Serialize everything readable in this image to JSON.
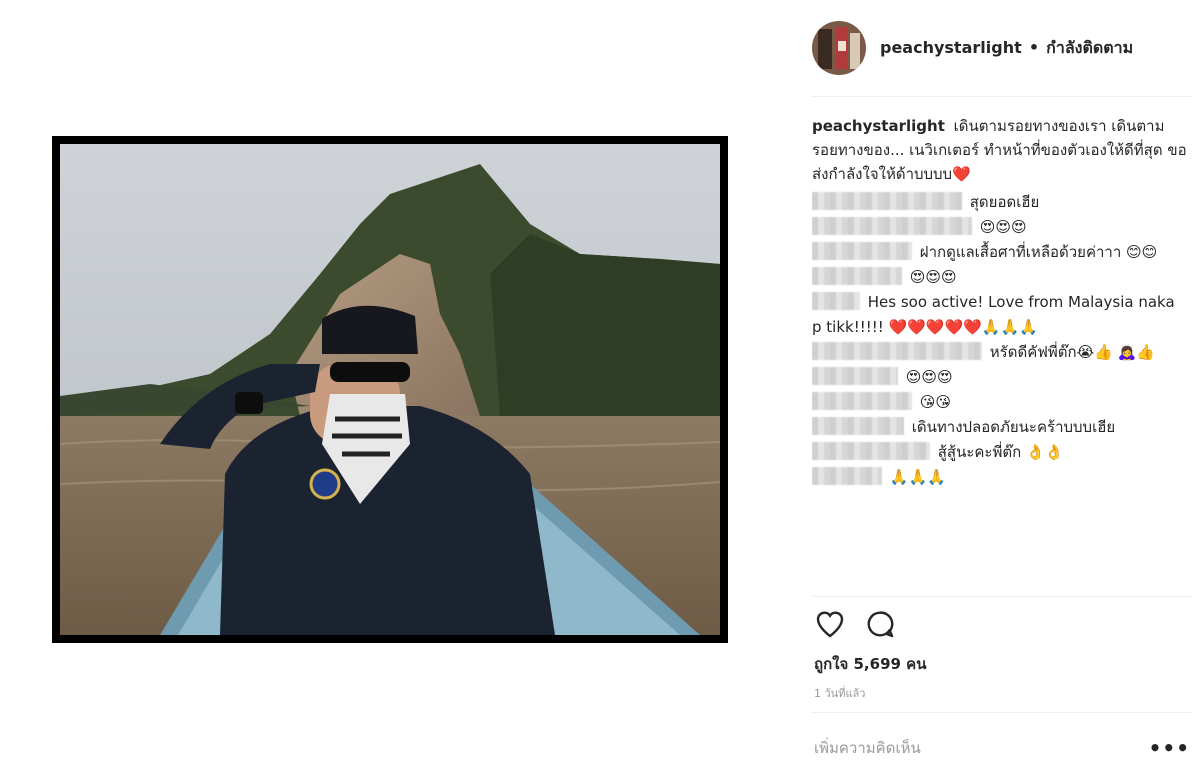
{
  "post": {
    "username": "peachystarlight",
    "dot": "•",
    "follow_status": "กำลังติดตาม",
    "caption_user": "peachystarlight",
    "caption_text": "เดินตามรอยทางของเรา เดินตามรอยทางของ... เนวิเกเตอร์ ทำหน้าที่ของตัวเองให้ดีที่สุด ขอส่งกำลังใจให้ด้าบบบบ❤️",
    "comments": [
      {
        "text": "สุดยอดเฮีย"
      },
      {
        "text": "😍😍😍"
      },
      {
        "text": "ฝากดูแลเสื้อศาที่เหลือด้วยค่าาา 😊😊"
      },
      {
        "text": "😍😍😍"
      },
      {
        "text": "Hes soo active! Love from Malaysia naka p tikk!!!!! ❤️❤️❤️❤️❤️🙏🙏🙏"
      },
      {
        "text": "หรัดดีคัฟพี่ต๊ก😭👍 🙇‍♀️👍"
      },
      {
        "text": "😍😍😍"
      },
      {
        "text": "😘😘"
      },
      {
        "text": "เดินทางปลอดภัยนะคร้าบบบเฮีย"
      },
      {
        "text": "สู้สู้นะคะพี่ต๊ก 👌👌"
      },
      {
        "text": "🙏🙏🙏"
      }
    ],
    "likes": "ถูกใจ 5,699 คน",
    "time": "1 วันที่แล้ว",
    "add_comment_placeholder": "เพิ่มความคิดเห็น",
    "more": "•••",
    "icons": {
      "like": "heart-icon",
      "comment": "comment-icon",
      "more": "more-options-icon"
    },
    "photo_alt": "Man in black cap and sunglasses saluting on a boat on a river near a tree-covered cliff"
  }
}
